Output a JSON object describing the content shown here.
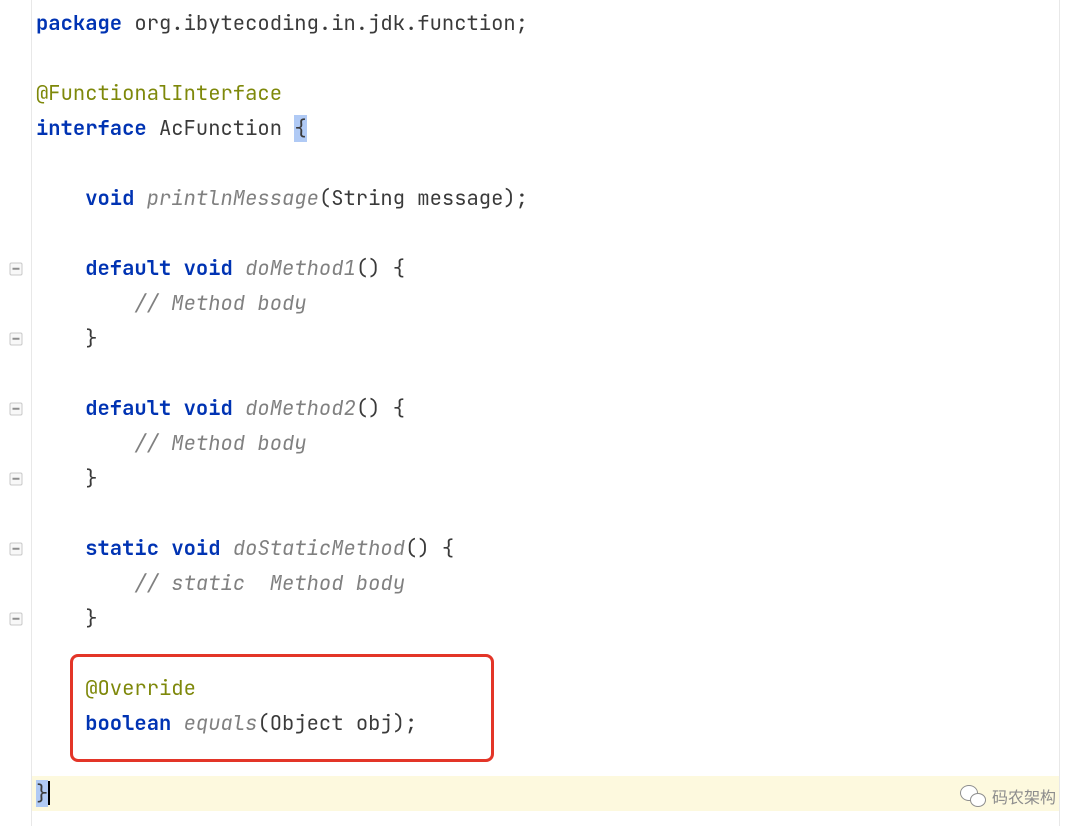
{
  "code": {
    "package_kw": "package",
    "package_name": " org.ibytecoding.in.jdk.function",
    "semi": ";",
    "annotation_fi": "@FunctionalInterface",
    "interface_kw": "interface",
    "interface_name": " AcFunction ",
    "open_brace": "{",
    "void_kw": "void",
    "println_name": " printlnMessage",
    "println_params": "(String message);",
    "default_kw": "default",
    "do1_name": " doMethod1",
    "empty_params_open": "() {",
    "comment_body": "// Method body",
    "close_brace": "}",
    "do2_name": " doMethod2",
    "static_kw": "static",
    "dostatic_name": " doStaticMethod",
    "comment_static": "// static  Method body",
    "annotation_ov": "@Override",
    "boolean_kw": "boolean",
    "equals_name": " equals",
    "equals_params": "(Object obj);",
    "final_close": "}"
  },
  "indent": {
    "i1": "    ",
    "i2": "        "
  },
  "watermark": {
    "label": "码农架构"
  }
}
